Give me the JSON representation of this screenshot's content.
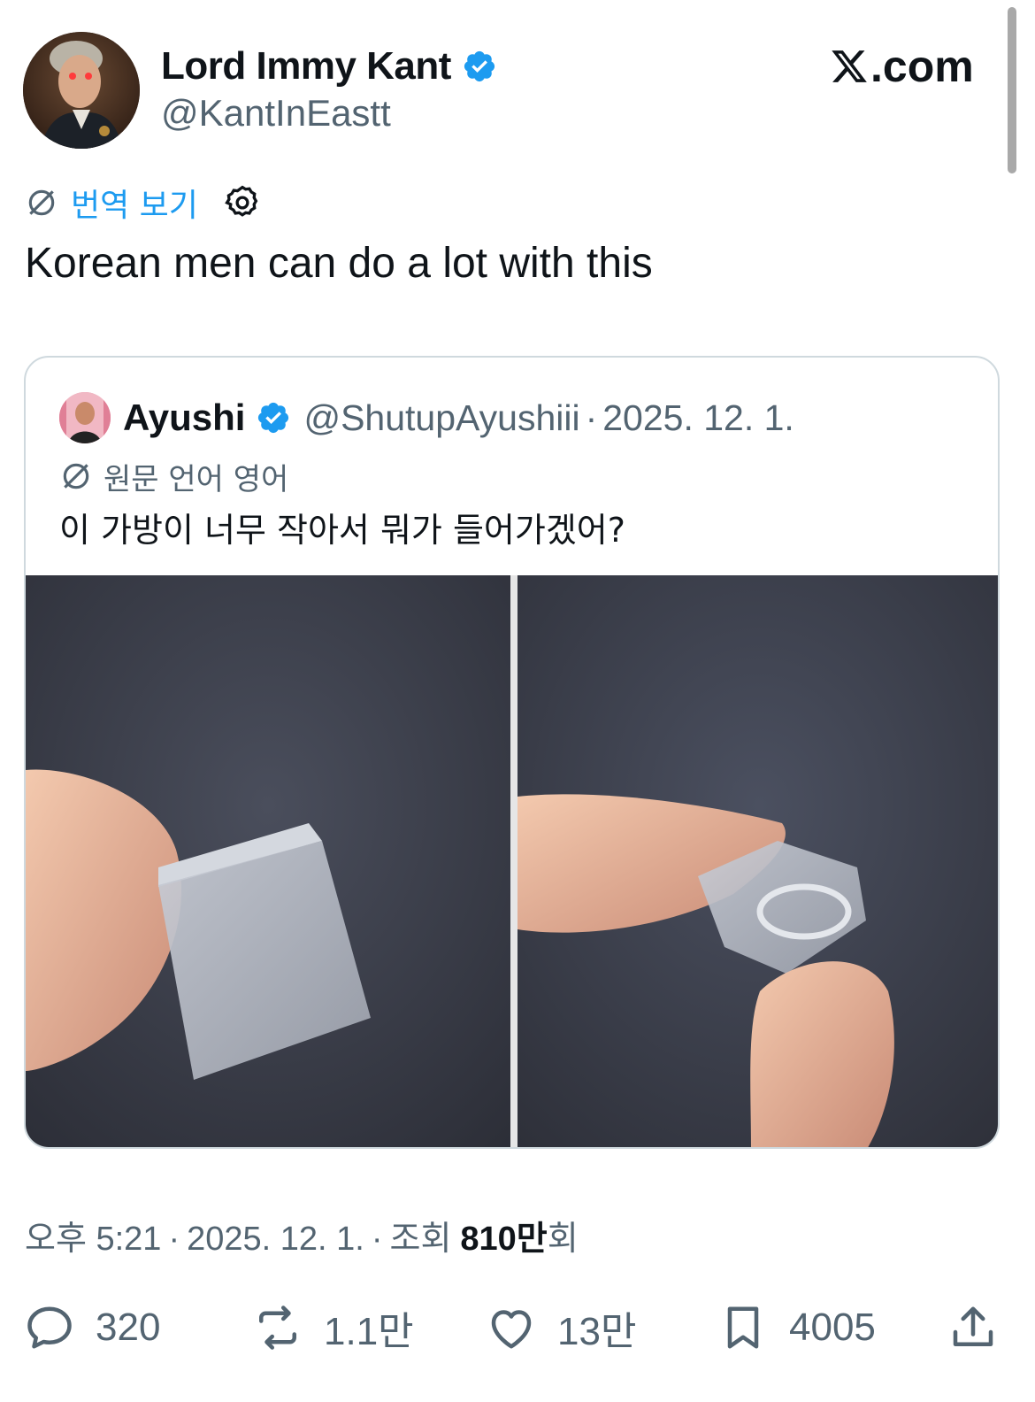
{
  "author": {
    "display_name": "Lord Immy Kant",
    "handle": "@KantInEastt",
    "verified": true
  },
  "site_label": ".com",
  "translate_label": "번역 보기",
  "tweet_text": "Korean men can do a lot with this",
  "quote": {
    "display_name": "Ayushi",
    "handle": "@ShutupAyushiii",
    "separator": "·",
    "date": "2025. 12. 1.",
    "language_note": "원문 언어 영어",
    "text": "이 가방이 너무 작아서 뭐가 들어가겠어?"
  },
  "meta": {
    "time": "오후 5:21",
    "date": "2025. 12. 1.",
    "views_prefix": "조회",
    "views_count": "810만",
    "views_suffix": "회"
  },
  "actions": {
    "replies": "320",
    "reposts": "1.1만",
    "likes": "13만",
    "bookmarks": "4005"
  },
  "colors": {
    "accent": "#1d9bf0",
    "secondary_text": "#536471",
    "primary_text": "#0f1419",
    "border": "#cfd9de"
  }
}
